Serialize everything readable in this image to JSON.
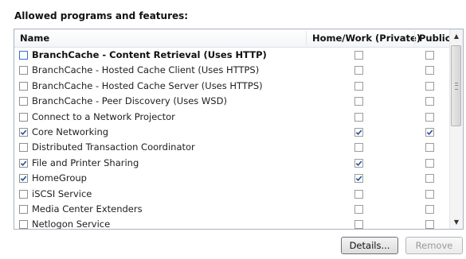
{
  "heading": "Allowed programs and features:",
  "columns": {
    "name": "Name",
    "home": "Home/Work (Private)",
    "public": "Public"
  },
  "rows": [
    {
      "name": "BranchCache - Content Retrieval (Uses HTTP)",
      "enabled": false,
      "home": false,
      "public": false,
      "selected": true
    },
    {
      "name": "BranchCache - Hosted Cache Client (Uses HTTPS)",
      "enabled": false,
      "home": false,
      "public": false
    },
    {
      "name": "BranchCache - Hosted Cache Server (Uses HTTPS)",
      "enabled": false,
      "home": false,
      "public": false
    },
    {
      "name": "BranchCache - Peer Discovery (Uses WSD)",
      "enabled": false,
      "home": false,
      "public": false
    },
    {
      "name": "Connect to a Network Projector",
      "enabled": false,
      "home": false,
      "public": false
    },
    {
      "name": "Core Networking",
      "enabled": true,
      "home": true,
      "public": true
    },
    {
      "name": "Distributed Transaction Coordinator",
      "enabled": false,
      "home": false,
      "public": false
    },
    {
      "name": "File and Printer Sharing",
      "enabled": true,
      "home": true,
      "public": false
    },
    {
      "name": "HomeGroup",
      "enabled": true,
      "home": true,
      "public": false
    },
    {
      "name": "iSCSI Service",
      "enabled": false,
      "home": false,
      "public": false
    },
    {
      "name": "Media Center Extenders",
      "enabled": false,
      "home": false,
      "public": false
    },
    {
      "name": "Netlogon Service",
      "enabled": false,
      "home": false,
      "public": false
    }
  ],
  "buttons": {
    "details": "Details...",
    "remove": "Remove"
  },
  "colors": {
    "check": "#1f4f9c",
    "selected_border": "#2b70c9"
  }
}
